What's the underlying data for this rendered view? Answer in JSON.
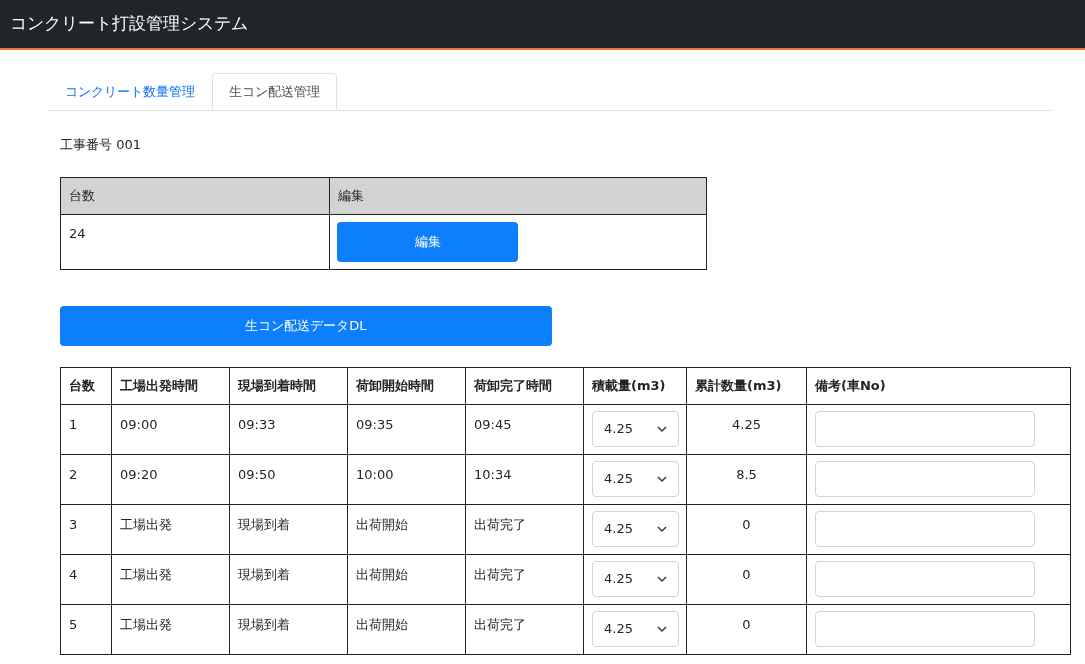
{
  "header": {
    "title": "コンクリート打設管理システム"
  },
  "tabs": [
    {
      "label": "コンクリート数量管理",
      "selected": false
    },
    {
      "label": "生コン配送管理",
      "selected": true
    }
  ],
  "project": {
    "label": "工事番号 001"
  },
  "summary": {
    "columns": [
      "台数",
      "編集"
    ],
    "count": "24",
    "edit_button": "編集"
  },
  "download_button": "生コン配送データDL",
  "table": {
    "columns": [
      "台数",
      "工場出発時間",
      "現場到着時間",
      "荷卸開始時間",
      "荷卸完了時間",
      "積載量(m3)",
      "累計数量(m3)",
      "備考(車No)"
    ],
    "rows": [
      {
        "no": "1",
        "times": [
          "09:00",
          "09:33",
          "09:35",
          "09:45"
        ],
        "load": "4.25",
        "total": "4.25"
      },
      {
        "no": "2",
        "times": [
          "09:20",
          "09:50",
          "10:00",
          "10:34"
        ],
        "load": "4.25",
        "total": "8.5"
      },
      {
        "no": "3",
        "times": [
          "工場出発",
          "現場到着",
          "出荷開始",
          "出荷完了"
        ],
        "load": "4.25",
        "total": "0"
      },
      {
        "no": "4",
        "times": [
          "工場出発",
          "現場到着",
          "出荷開始",
          "出荷完了"
        ],
        "load": "4.25",
        "total": "0"
      },
      {
        "no": "5",
        "times": [
          "工場出発",
          "現場到着",
          "出荷開始",
          "出荷完了"
        ],
        "load": "4.25",
        "total": "0"
      }
    ]
  }
}
